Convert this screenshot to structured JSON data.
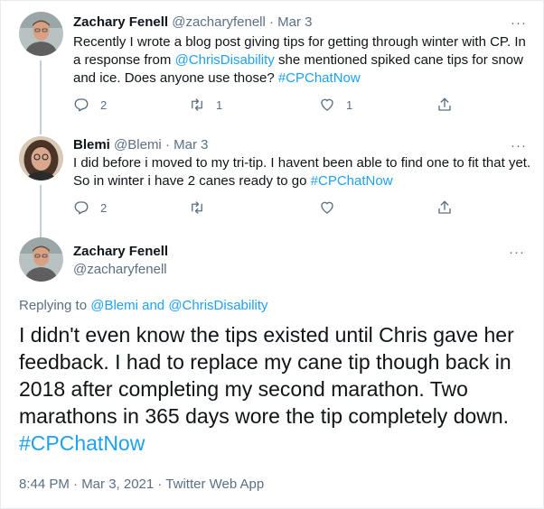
{
  "tweets": [
    {
      "name": "Zachary Fenell",
      "handle": "@zacharyfenell",
      "separator": "·",
      "date": "Mar 3",
      "more": "···",
      "text_parts": {
        "a": "Recently I wrote a blog post giving tips for getting through winter with CP. In a response from ",
        "mention": "@ChrisDisability",
        "b": " she mentioned spiked cane tips for snow and ice. Does anyone use those? ",
        "hashtag": "#CPChatNow"
      },
      "replies": "2",
      "retweets": "1",
      "likes": "1"
    },
    {
      "name": "Blemi",
      "handle": "@Blemi",
      "separator": "·",
      "date": "Mar 3",
      "more": "···",
      "text_parts": {
        "a": "I did before i moved to my tri-tip. I havent been able to find one to fit that yet.  So in winter i have 2 canes ready to go ",
        "hashtag": "#CPChatNow"
      },
      "replies": "2"
    }
  ],
  "main": {
    "name": "Zachary Fenell",
    "handle": "@zacharyfenell",
    "more": "···",
    "replying_prefix": "Replying to ",
    "replying_to": "@Blemi and @ChrisDisability",
    "text": "I didn't even know the tips existed until Chris gave her feedback. I had to replace my cane tip though back in 2018 after completing my second marathon. Two marathons in 365 days wore the tip completely down. ",
    "hashtag": "#CPChatNow",
    "timestamp": "8:44 PM · Mar 3, 2021 · Twitter Web App"
  },
  "icons": {
    "reply": "reply-icon",
    "retweet": "retweet-icon",
    "like": "like-icon",
    "share": "share-icon",
    "more": "more-icon"
  },
  "colors": {
    "link": "#1da1f2",
    "secondary": "#5b7083",
    "text": "#0f1419",
    "thread_line": "#c4cfd6"
  }
}
